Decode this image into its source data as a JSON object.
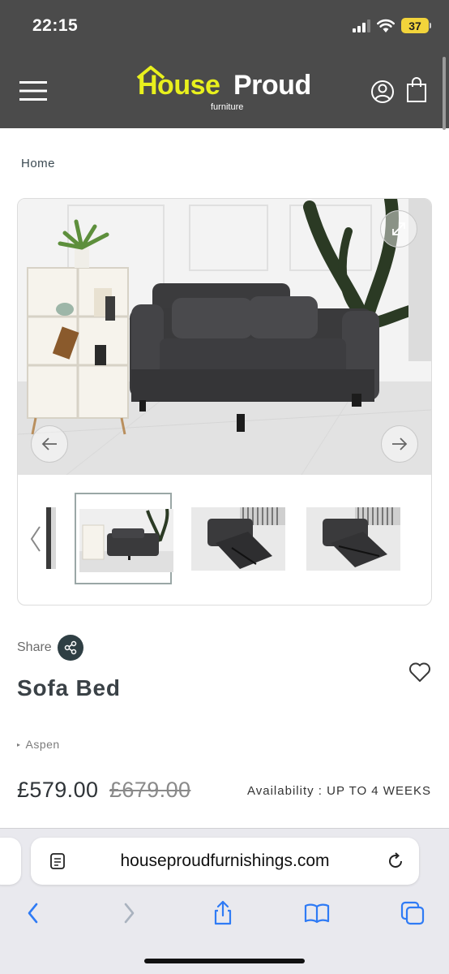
{
  "status_bar": {
    "time": "22:15",
    "battery": "37"
  },
  "header": {
    "logo_primary": "House",
    "logo_secondary": "Proud",
    "logo_sub": "furniture",
    "menu_icon": "hamburger-menu-icon",
    "account_icon": "user-account-icon",
    "cart_icon": "shopping-bag-icon",
    "brand_color": "#e8f01d",
    "background": "#4b4b4b"
  },
  "breadcrumb": {
    "home": "Home"
  },
  "gallery": {
    "expand_icon": "expand-arrows-icon",
    "prev_icon": "arrow-left-icon",
    "next_icon": "arrow-right-icon",
    "thumbnails": [
      {
        "name": "sofa-bed-front-view"
      },
      {
        "name": "sofa-bed-extended-view"
      },
      {
        "name": "sofa-bed-extended-view-alt"
      }
    ]
  },
  "product": {
    "share_label": "Share",
    "title": "Sofa Bed",
    "brand": "Aspen",
    "price": "£579.00",
    "old_price": "£679.00",
    "availability": "Availability : UP TO 4 WEEKS"
  },
  "browser": {
    "url": "houseproudfurnishings.com",
    "reader_icon": "reader-view-icon",
    "reload_icon": "reload-icon",
    "toolbar": [
      "back-icon",
      "forward-icon",
      "share-icon",
      "bookmarks-icon",
      "tabs-icon"
    ]
  }
}
